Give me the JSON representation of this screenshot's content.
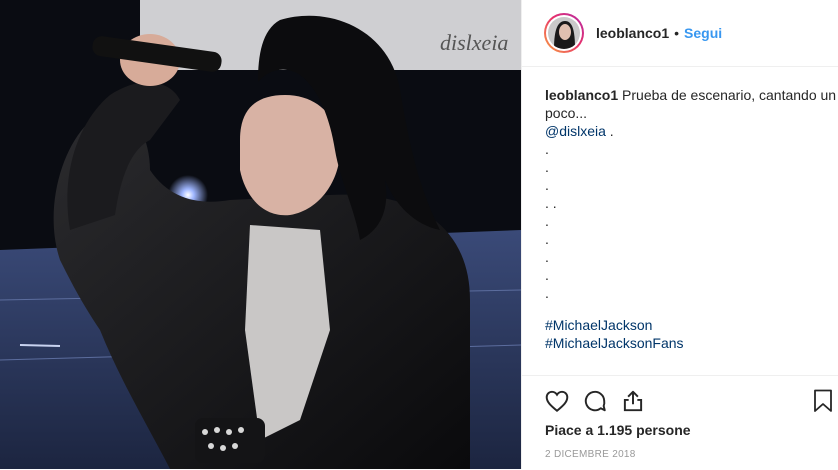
{
  "post": {
    "username": "leoblanco1",
    "dot": "•",
    "follow_label": "Segui",
    "caption_text": "Prueba de escenario, cantando un poco...",
    "mention": "@dislxeia",
    "mention_suffix": " .",
    "dots": [
      ".",
      ".",
      ".",
      ". .",
      ".",
      ".",
      ".",
      ".",
      "."
    ],
    "hashtags": [
      "#MichaelJackson",
      "#MichaelJacksonFans"
    ],
    "likes": "Piace a 1.195 persone",
    "date": "2 DICEMBRE 2018",
    "banner_text": "dislxeia"
  },
  "colors": {
    "link_blue": "#3897f0",
    "mention_blue": "#003569",
    "muted": "#999999"
  },
  "icons": [
    "heart-icon",
    "comment-icon",
    "share-icon",
    "bookmark-icon"
  ]
}
